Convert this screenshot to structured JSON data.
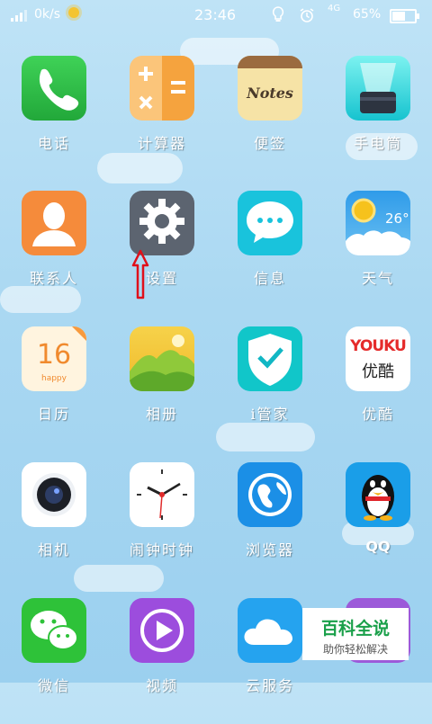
{
  "status_bar": {
    "speed": "0k/s",
    "time": "23:46",
    "network": "4G",
    "battery": "65%",
    "battery_level": 0.65,
    "icons": [
      "signal-icon",
      "weather-sun-icon",
      "lightbulb-icon",
      "alarm-icon",
      "battery-icon"
    ]
  },
  "apps": [
    {
      "label": "电话",
      "icon": "phone-icon",
      "color": "#2fbf4a"
    },
    {
      "label": "计算器",
      "icon": "calculator-icon",
      "color": "#f7a541"
    },
    {
      "label": "便签",
      "icon": "notes-icon",
      "color": "#f6e3a6",
      "icon_text": "Notes"
    },
    {
      "label": "手电筒",
      "icon": "flashlight-icon",
      "color": "#2ad7d8"
    },
    {
      "label": "联系人",
      "icon": "contacts-icon",
      "color": "#f58b3b"
    },
    {
      "label": "设置",
      "icon": "settings-gear-icon",
      "color": "#5c6470"
    },
    {
      "label": "信息",
      "icon": "messages-icon",
      "color": "#19c3dc"
    },
    {
      "label": "天气",
      "icon": "weather-icon",
      "color": "#3aa7f0",
      "icon_text": "26°"
    },
    {
      "label": "日历",
      "icon": "calendar-icon",
      "color": "#fff4df",
      "icon_text": "16",
      "icon_subtext": "happy"
    },
    {
      "label": "相册",
      "icon": "gallery-icon",
      "color": "#f1c93b"
    },
    {
      "label": "i管家",
      "icon": "security-shield-icon",
      "color": "#11c6c9"
    },
    {
      "label": "优酷",
      "icon": "youku-icon",
      "color": "#ffffff",
      "icon_text": "YOUKU",
      "icon_subtext": "优酷"
    },
    {
      "label": "相机",
      "icon": "camera-icon",
      "color": "#ffffff"
    },
    {
      "label": "闹钟时钟",
      "icon": "clock-icon",
      "color": "#ffffff"
    },
    {
      "label": "浏览器",
      "icon": "browser-globe-icon",
      "color": "#1b8fe6"
    },
    {
      "label": "QQ",
      "icon": "qq-penguin-icon",
      "color": "#1a9ee8"
    },
    {
      "label": "微信",
      "icon": "wechat-icon",
      "color": "#2ec239"
    },
    {
      "label": "视频",
      "icon": "video-play-icon",
      "color": "#9c4ddd"
    },
    {
      "label": "云服务",
      "icon": "cloud-service-icon",
      "color": "#25a3ef"
    },
    {
      "label": "",
      "icon": "app-icon",
      "color": "#9c5ad9"
    }
  ],
  "annotation": {
    "icon": "red-arrow-up-icon",
    "color": "#e0101a"
  },
  "watermark": {
    "title": "百科全说",
    "subtitle": "助你轻松解决"
  }
}
